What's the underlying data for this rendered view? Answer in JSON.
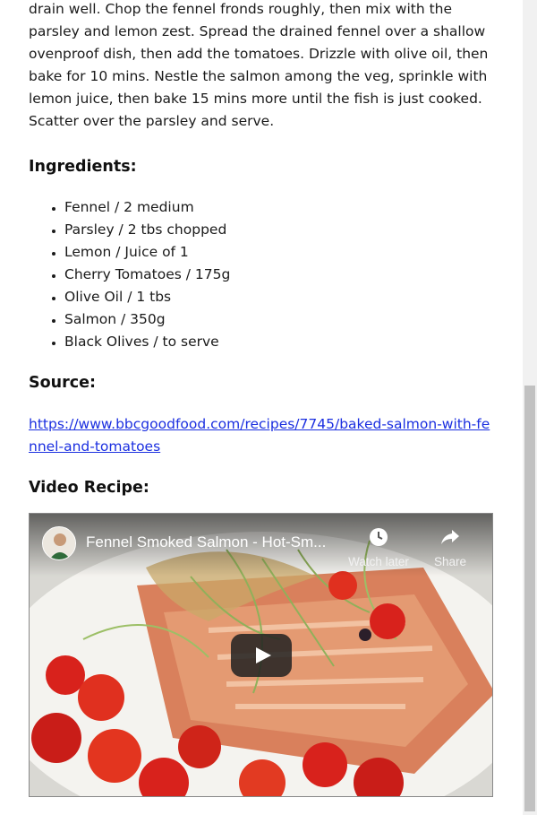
{
  "method_text": "drain well. Chop the fennel fronds roughly, then mix with the parsley and lemon zest. Spread the drained fennel over a shallow ovenproof dish, then add the tomatoes. Drizzle with olive oil, then bake for 10 mins. Nestle the salmon among the veg, sprinkle with lemon juice, then bake 15 mins more until the fish is just cooked. Scatter over the parsley and serve.",
  "ingredients": {
    "heading": "Ingredients:",
    "items": [
      "Fennel / 2 medium",
      "Parsley / 2 tbs chopped",
      "Lemon / Juice of 1",
      "Cherry Tomatoes / 175g",
      "Olive Oil / 1 tbs",
      "Salmon / 350g",
      "Black Olives / to serve"
    ]
  },
  "source": {
    "heading": "Source:",
    "link_text": "https://www.bbcgoodfood.com/recipes/7745/baked-salmon-with-fennel-and-tomatoes"
  },
  "video_recipe": {
    "heading": "Video Recipe:",
    "title": "Fennel Smoked Salmon - Hot-Sm...",
    "watch_later": "Watch later",
    "share": "Share"
  },
  "colors": {
    "link": "#1b2fe0",
    "salmon": "#d9805c",
    "tomato": "#d8221c"
  },
  "icons": [
    "clock-icon",
    "share-arrow-icon",
    "play-icon",
    "channel-avatar"
  ]
}
